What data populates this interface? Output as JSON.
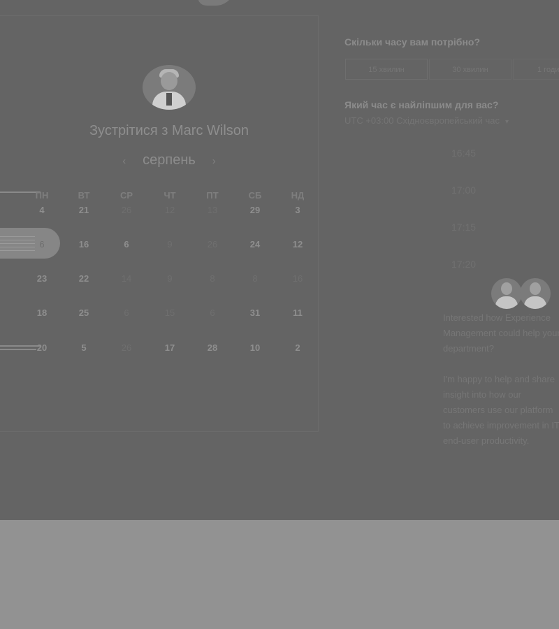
{
  "booking": {
    "title": "Зустрітися з Marc Wilson",
    "month": "серпень",
    "prev_arrow": "‹",
    "next_arrow": "›"
  },
  "calendar": {
    "weekdays": [
      "ПН",
      "ВТ",
      "СР",
      "ЧТ",
      "ПТ",
      "СБ",
      "НД"
    ],
    "weeks": [
      [
        "4",
        "21",
        "26",
        "12",
        "13",
        "29",
        "3"
      ],
      [
        "6",
        "16",
        "6",
        "9",
        "26",
        "24",
        "12"
      ],
      [
        "23",
        "22",
        "14",
        "9",
        "8",
        "8",
        "16"
      ],
      [
        "18",
        "25",
        "6",
        "15",
        "6",
        "31",
        "11"
      ],
      [
        "20",
        "5",
        "26",
        "17",
        "28",
        "10",
        "2"
      ]
    ],
    "selected_day": "6"
  },
  "duration": {
    "heading": "Скільки часу вам потрібно?",
    "options": [
      "15 хвилин",
      "30 хвилин",
      "1 годи"
    ]
  },
  "time": {
    "heading": "Який час є найліпшим для вас?",
    "timezone": "UTC +03:00 Східноєвропейський час",
    "timezone_chevron": "▾",
    "slots": [
      "16:45",
      "17:00",
      "17:15",
      "17:20"
    ]
  },
  "message": {
    "para1": "Interested how Experience Management could help your department?",
    "para2": "I'm happy to help and share insight into how our customers use our platform to achieve improvement in IT end-user productivity."
  }
}
